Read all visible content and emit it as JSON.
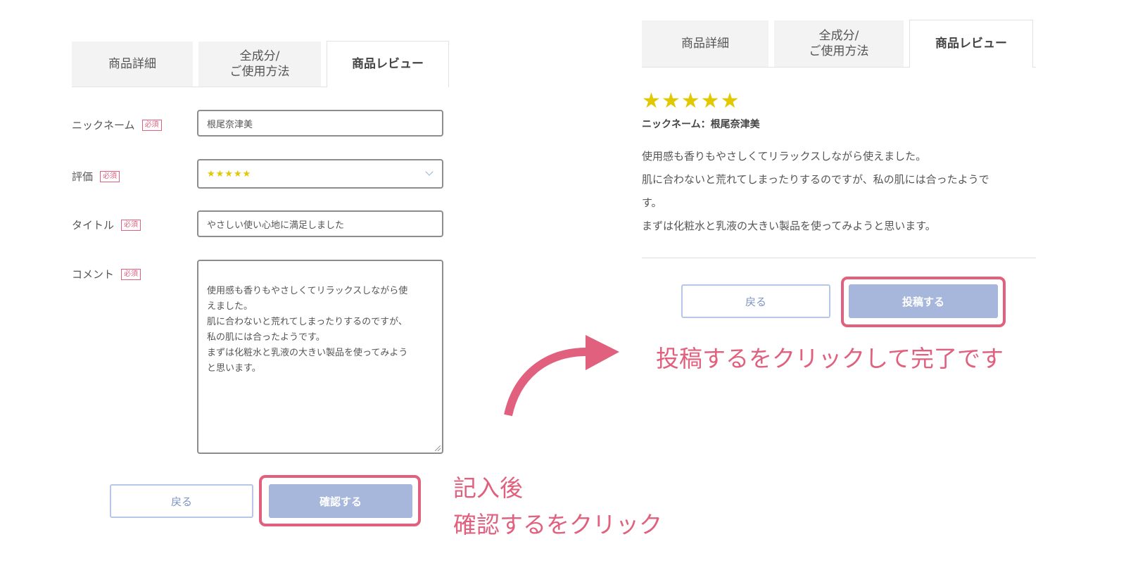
{
  "left": {
    "tabs": [
      {
        "label": "商品詳細"
      },
      {
        "label": "全成分/\nご使用方法"
      },
      {
        "label": "商品レビュー"
      }
    ],
    "required_badge": "必須",
    "fields": {
      "nickname": {
        "label": "ニックネーム",
        "value": "根尾奈津美"
      },
      "rating": {
        "label": "評価",
        "value": "★★★★★",
        "stars": 5
      },
      "title": {
        "label": "タイトル",
        "value": "やさしい使い心地に満足しました"
      },
      "comment": {
        "label": "コメント",
        "value": "使用感も香りもやさしくてリラックスしながら使\nえました。\n肌に合わないと荒れてしまったりするのですが、\n私の肌には合ったようです。\nまずは化粧水と乳液の大きい製品を使ってみよう\nと思います。"
      }
    },
    "back_label": "戻る",
    "confirm_label": "確認する"
  },
  "right": {
    "tabs": [
      {
        "label": "商品詳細"
      },
      {
        "label": "全成分/\nご使用方法"
      },
      {
        "label": "商品レビュー"
      }
    ],
    "stars": "★★★★★",
    "rating": 5,
    "nickname_line": "ニックネーム：根尾奈津美",
    "comment": "使用感も香りもやさしくてリラックスしながら使えました。\n肌に合わないと荒れてしまったりするのですが、私の肌には合ったようで\nす。\nまずは化粧水と乳液の大きい製品を使ってみようと思います。",
    "back_label": "戻る",
    "post_label": "投稿する"
  },
  "annotations": {
    "step1_line1": "記入後",
    "step1_line2": "確認するをクリック",
    "step2": "投稿するをクリックして完了です"
  },
  "colors": {
    "accent": "#e0607e",
    "star": "#e2c800",
    "button_primary": "#a7b7dc",
    "button_border": "#b7c7e8"
  }
}
